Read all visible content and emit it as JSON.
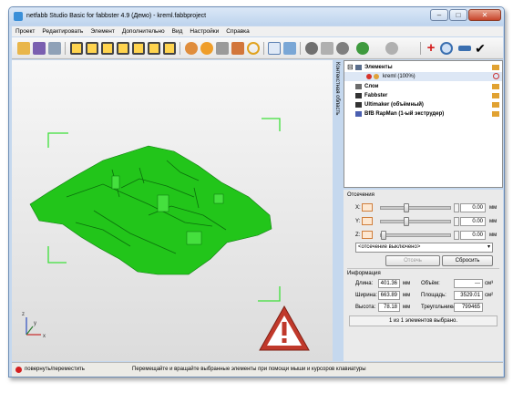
{
  "title": "netfabb Studio Basic for fabbster 4.9 (Демо) - kreml.fabbproject",
  "window_buttons": {
    "minimize": "–",
    "maximize": "□",
    "close": "✕"
  },
  "menu": [
    "Проект",
    "Редактировать",
    "Элемент",
    "Дополнительно",
    "Вид",
    "Настройки",
    "Справка"
  ],
  "side_tab": "Контекстная область",
  "tree": {
    "root": "Элементы",
    "child": "kreml (100%)",
    "items": [
      "Слои",
      "Fabbster",
      "Ultimaker (объёмный)",
      "BfB RapMan (1-ый экструдер)"
    ]
  },
  "cuts": {
    "title": "Отсечения",
    "axes": [
      {
        "label": "X:",
        "value": "0.00",
        "unit": "мм",
        "level": 0.35
      },
      {
        "label": "Y:",
        "value": "0.00",
        "unit": "мм",
        "level": 0.35
      },
      {
        "label": "Z:",
        "value": "0.00",
        "unit": "мм",
        "level": 0.0
      }
    ],
    "dropdown": "<отсечение выключено>",
    "cut_button": "Отсечь",
    "reset_button": "Сбросить"
  },
  "info": {
    "title": "Информация",
    "length_label": "Длина:",
    "length_value": "401.36",
    "length_unit": "мм",
    "width_label": "Ширина:",
    "width_value": "663.89",
    "width_unit": "мм",
    "height_label": "Высота:",
    "height_value": "78.18",
    "height_unit": "мм",
    "volume_label": "Объём:",
    "volume_value": "---",
    "volume_unit": "см³",
    "area_label": "Площадь:",
    "area_value": "3529.01",
    "area_unit": "см²",
    "triangles_label": "Треугольники:",
    "triangles_value": "799465",
    "selection_status": "1 из 1 элементов выбрано."
  },
  "status": {
    "mode": "повернуть/переместить",
    "hint": "Перемещайте и вращайте выбранные элементы при помощи мыши и курсоров клавиатуры"
  },
  "axis_labels": {
    "x": "x",
    "y": "y",
    "z": "z"
  },
  "colors": {
    "model": "#22c51a",
    "warning": "#c0392b",
    "accent": "#3a8fd8"
  }
}
